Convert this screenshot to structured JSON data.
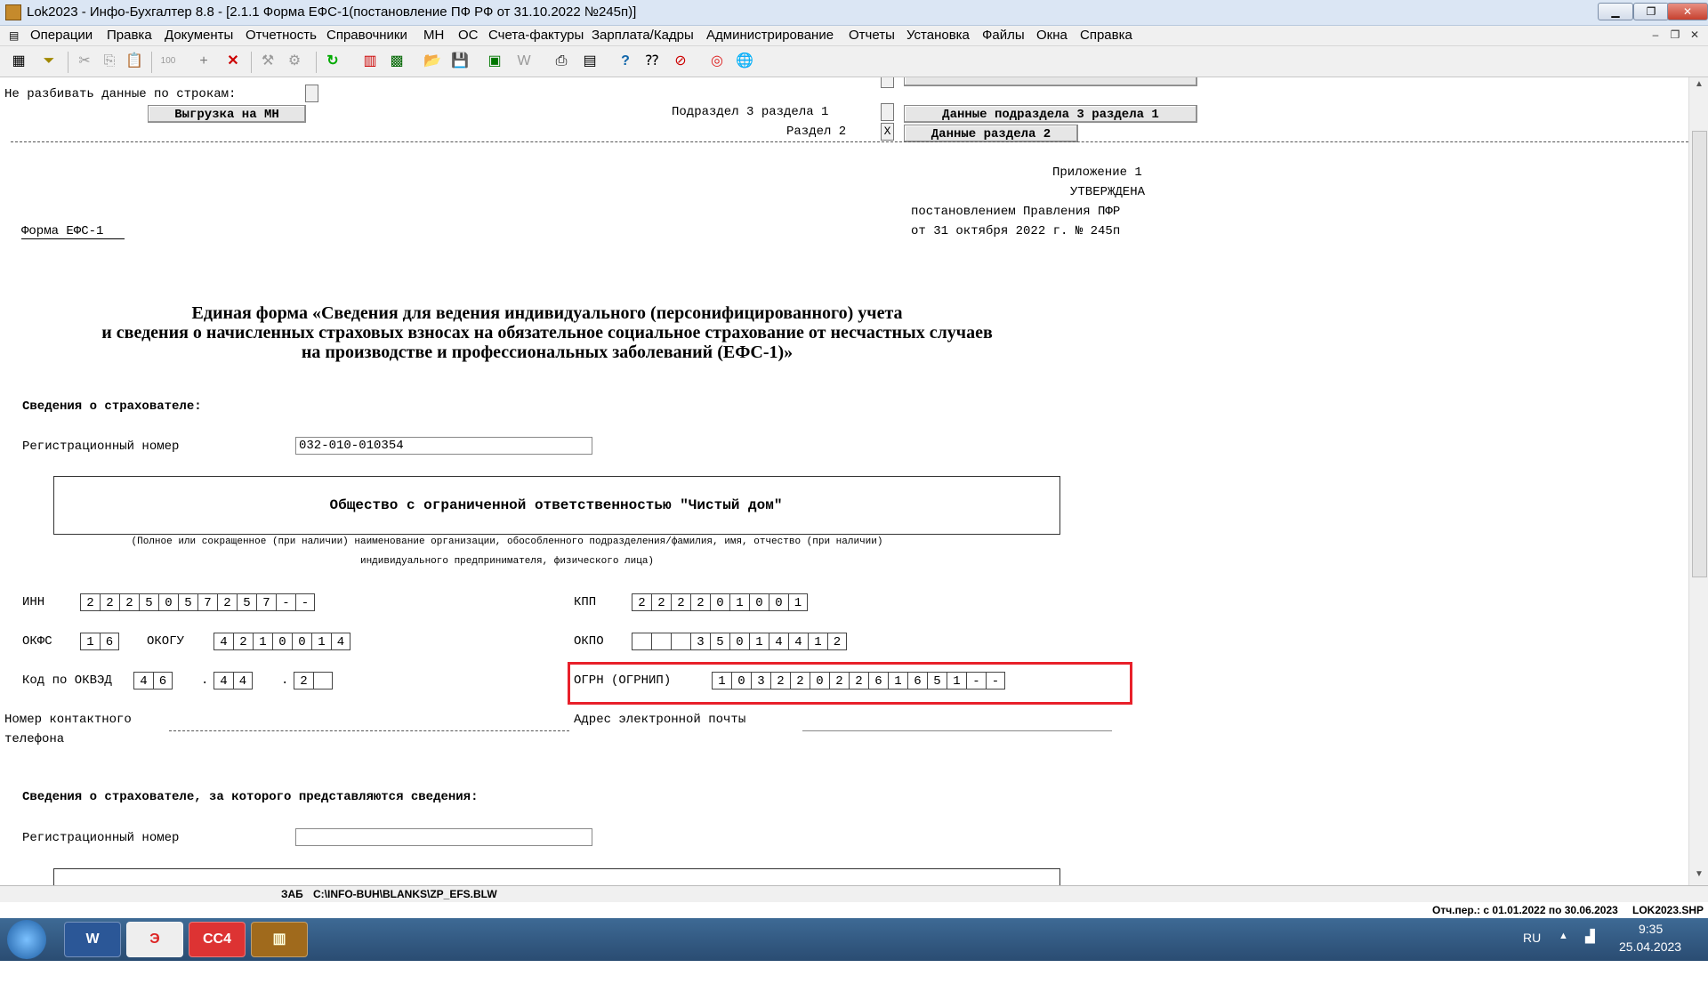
{
  "window": {
    "title": "Lok2023 - Инфо-Бухгалтер 8.8 - [2.1.1    Форма ЕФС-1(постановление ПФ РФ от 31.10.2022 №245п)]",
    "minimize": "▁",
    "restore": "❐",
    "close": "✕"
  },
  "menu": [
    "Операции",
    "Правка",
    "Документы",
    "Отчетность",
    "Справочники",
    "МН",
    "ОС",
    "Счета-фактуры",
    "Зарплата/Кадры",
    "Администрирование",
    "Отчеты",
    "Установка",
    "Файлы",
    "Окна",
    "Справка"
  ],
  "form_top": {
    "no_split_label": "Не разбивать данные по строкам:",
    "export_button": "Выгрузка на МН",
    "subsection_label": "Подраздел 3 раздела 1",
    "subsection_button": "Данные подраздела 3 раздела 1",
    "section2_label": "Раздел 2",
    "section2_check": "X",
    "section2_button": "Данные раздела 2"
  },
  "header": {
    "appendix": "Приложение 1",
    "approved": "УТВЕРЖДЕНА",
    "decree": "постановлением Правления ПФР",
    "date": "от 31 октября 2022 г. № 245п",
    "form_name": "Форма ЕФС-1",
    "title_line1": "Единая форма «Сведения для ведения индивидуального (персонифицированного) учета",
    "title_line2": "и сведения о начисленных страховых взносах на обязательное социальное страхование от несчастных случаев",
    "title_line3": "на производстве и профессиональных заболеваний (ЕФС-1)»"
  },
  "insurer": {
    "section_title": "Сведения о страхователе:",
    "reg_label": "Регистрационный номер",
    "reg_value": "032-010-010354",
    "org_name": "Общество с ограниченной ответственностью \"Чистый дом\"",
    "org_hint_line1": "(Полное или сокращенное (при наличии) наименование организации, обособленного подразделения/фамилия, имя, отчество (при наличии)",
    "org_hint_line2": "индивидуального предпринимателя, физического лица)",
    "inn_label": "ИНН",
    "inn": [
      "2",
      "2",
      "2",
      "5",
      "0",
      "5",
      "7",
      "2",
      "5",
      "7",
      "-",
      "-"
    ],
    "kpp_label": "КПП",
    "kpp": [
      "2",
      "2",
      "2",
      "2",
      "0",
      "1",
      "0",
      "0",
      "1"
    ],
    "okfs_label": "ОКФС",
    "okfs": [
      "1",
      "6"
    ],
    "okogu_label": "ОКОГУ",
    "okogu": [
      "4",
      "2",
      "1",
      "0",
      "0",
      "1",
      "4"
    ],
    "okpo_label": "ОКПО",
    "okpo": [
      "",
      "",
      "",
      "3",
      "5",
      "0",
      "1",
      "4",
      "4",
      "1",
      "2"
    ],
    "okved_label": "Код по ОКВЭД",
    "okved1": [
      "4",
      "6"
    ],
    "okved2": [
      "4",
      "4"
    ],
    "okved3": [
      "2",
      ""
    ],
    "okved_dot": ".",
    "ogrn_label": "ОГРН (ОГРНИП)",
    "ogrn": [
      "1",
      "0",
      "3",
      "2",
      "2",
      "0",
      "2",
      "2",
      "6",
      "1",
      "6",
      "5",
      "1",
      "-",
      "-"
    ],
    "phone_label_1": "Номер контактного",
    "phone_label_2": "телефона",
    "email_label": "Адрес электронной почты"
  },
  "insured_for": {
    "section_title": "Сведения о страхователе, за которого представляются сведения:",
    "reg_label": "Регистрационный номер",
    "reg_value": ""
  },
  "status": {
    "mode": "ЗАБ",
    "path": "C:\\INFO-BUH\\BLANKS\\ZP_EFS.BLW",
    "period": "Отч.пер.: с 01.01.2022 по 30.06.2023",
    "file": "LOK2023.SHP"
  },
  "taskbar": {
    "apps": [
      "word",
      "ie-like",
      "cc4",
      "abacus"
    ],
    "cc4_label": "CC4",
    "lang": "RU",
    "time": "9:35",
    "date": "25.04.2023"
  }
}
